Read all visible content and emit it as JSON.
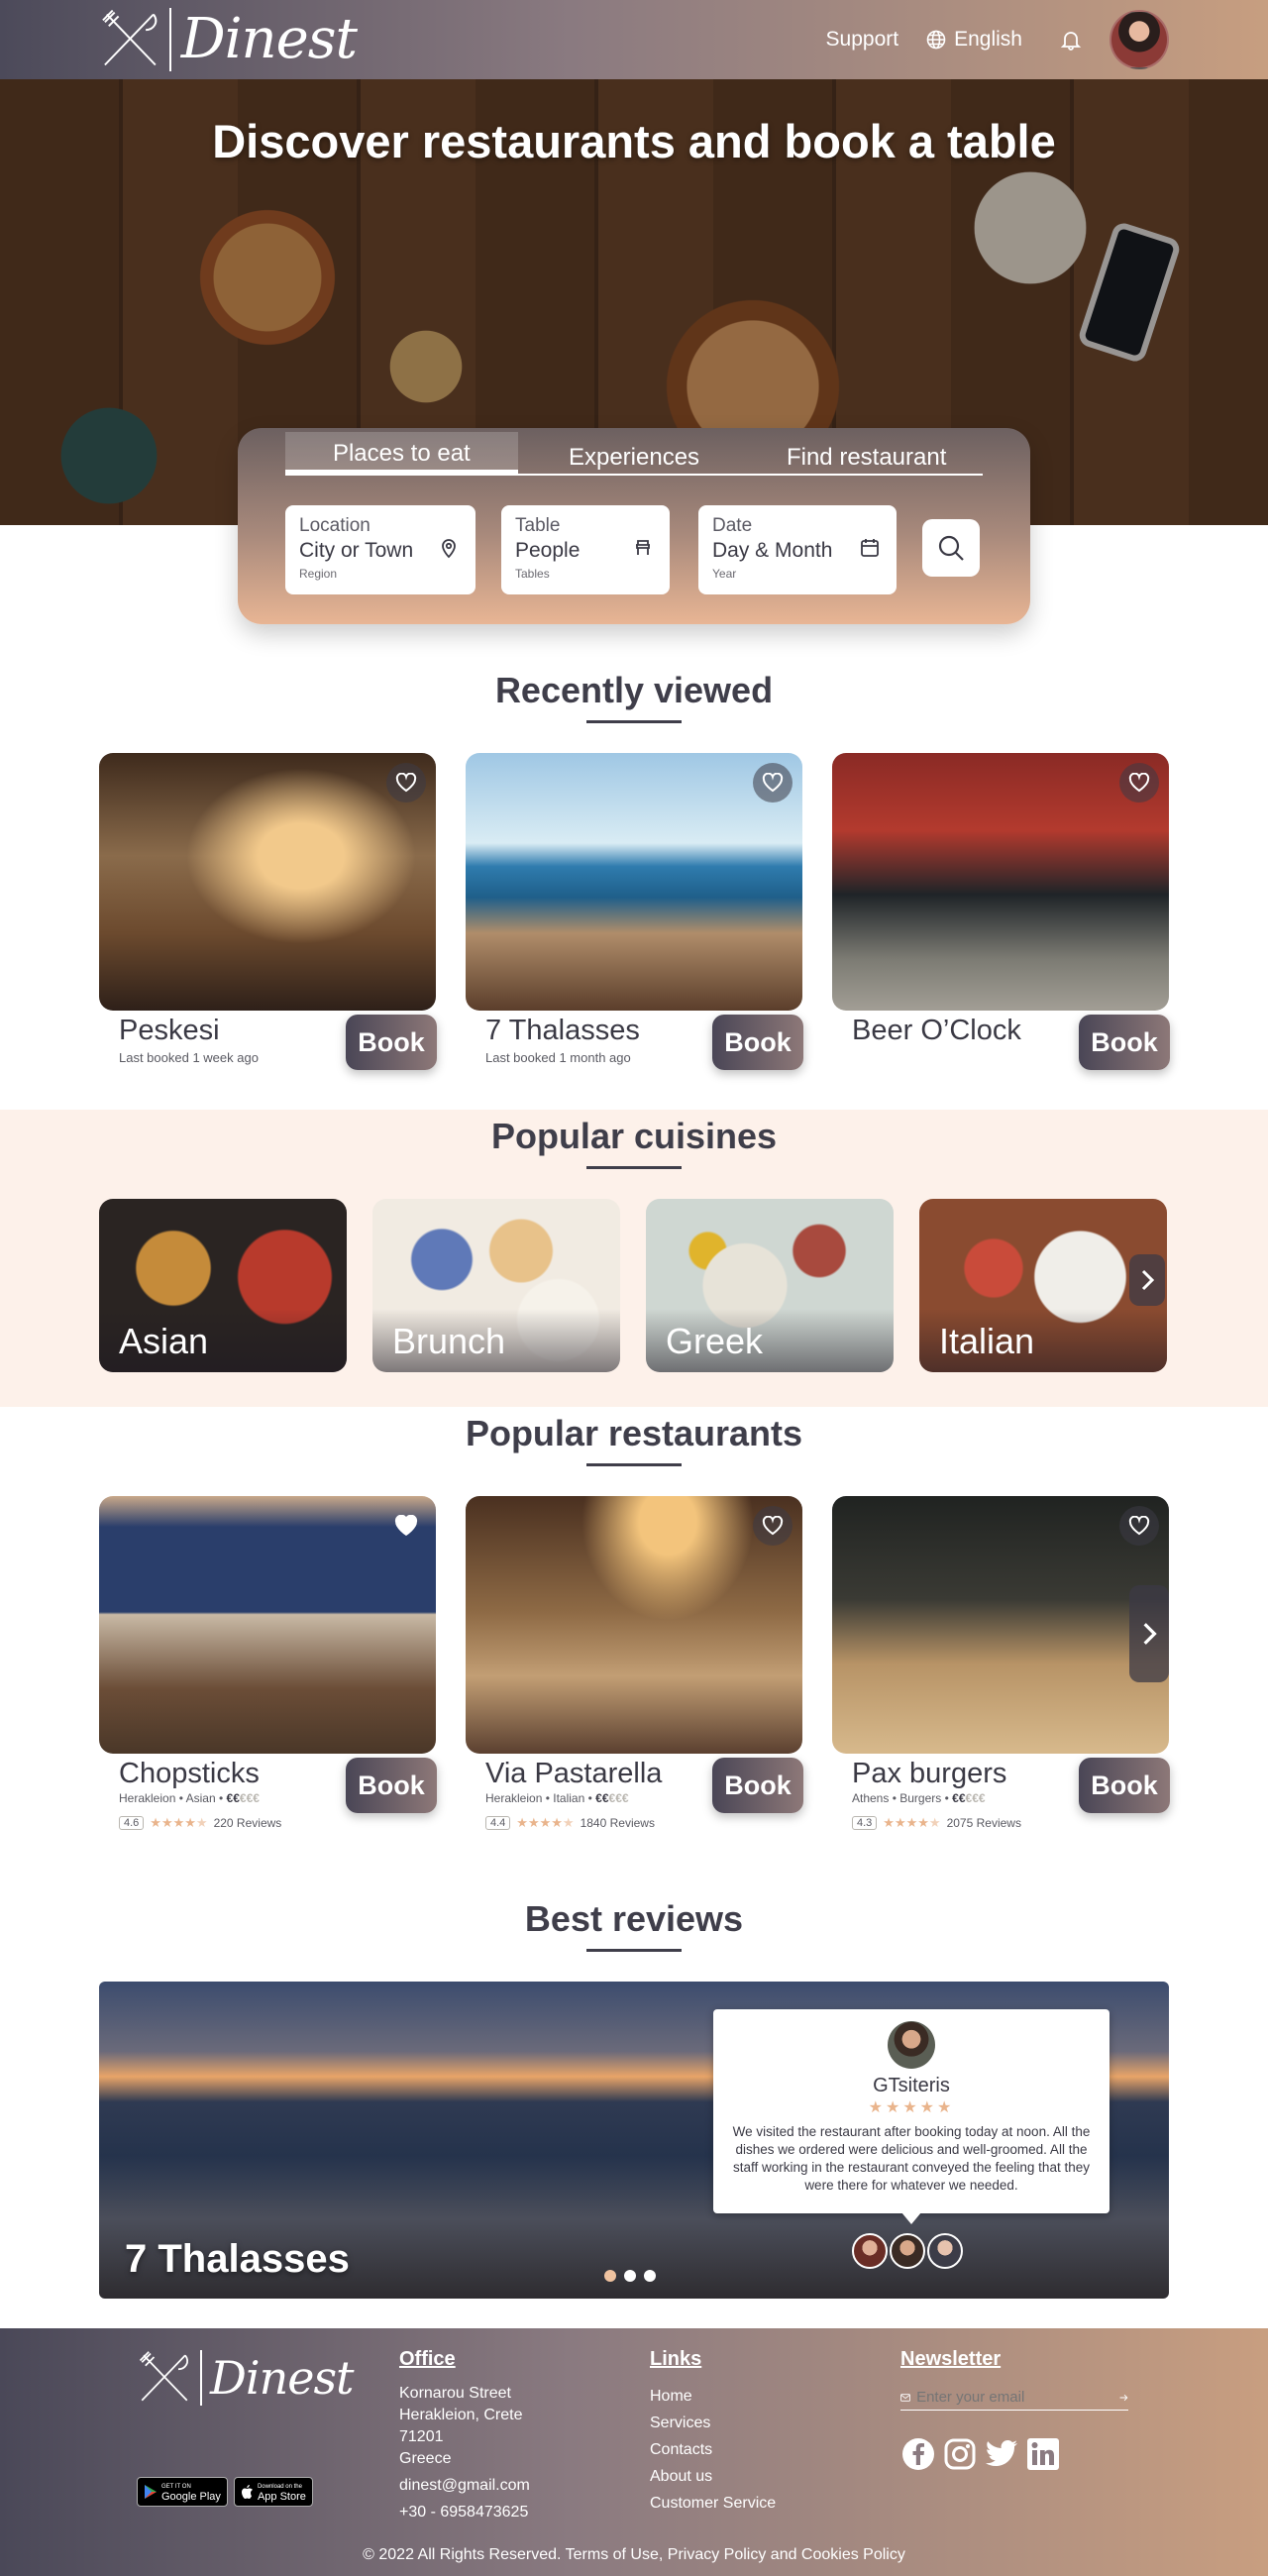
{
  "header": {
    "brand": "Dinest",
    "nav": {
      "support": "Support",
      "language": "English"
    }
  },
  "hero": {
    "title": "Discover restaurants and book a table"
  },
  "search": {
    "tabs": [
      "Places to eat",
      "Experiences",
      "Find restaurant"
    ],
    "location": {
      "label": "Location",
      "value": "City or Town",
      "sub": "Region"
    },
    "table": {
      "label": "Table",
      "value": "People",
      "sub": "Tables"
    },
    "date": {
      "label": "Date",
      "value": "Day & Month",
      "sub": "Year"
    }
  },
  "recently_viewed": {
    "title": "Recently viewed",
    "book_label": "Book",
    "items": [
      {
        "name": "Peskesi",
        "meta": "Last booked 1 week ago"
      },
      {
        "name": "7 Thalasses",
        "meta": "Last booked 1 month ago"
      },
      {
        "name": "Beer O’Clock",
        "meta": ""
      }
    ]
  },
  "cuisines": {
    "title": "Popular cuisines",
    "items": [
      "Asian",
      "Brunch",
      "Greek",
      "Italian"
    ]
  },
  "popular": {
    "title": "Popular restaurants",
    "book_label": "Book",
    "items": [
      {
        "name": "Chopsticks",
        "location": "Herakleion",
        "cuisine": "Asian",
        "price_level": 2,
        "rating": "4.6",
        "stars": 4.6,
        "reviews": "220 Reviews"
      },
      {
        "name": "Via Pastarella",
        "location": "Herakleion",
        "cuisine": "Italian",
        "price_level": 2,
        "rating": "4.4",
        "stars": 4.4,
        "reviews": "1840 Reviews"
      },
      {
        "name": "Pax burgers",
        "location": "Athens",
        "cuisine": "Burgers",
        "price_level": 2,
        "rating": "4.3",
        "stars": 4.3,
        "reviews": "2075 Reviews"
      }
    ]
  },
  "reviews": {
    "title": "Best reviews",
    "restaurant": "7 Thalasses",
    "reviewer": "GTsiteris",
    "stars": 5,
    "text": "We visited the restaurant after booking today at noon. All the dishes we ordered were delicious and well-groomed. All the staff working in the restaurant conveyed the feeling that they were there for whatever we needed.",
    "active_slide": 1,
    "slide_count": 3
  },
  "footer": {
    "brand": "Dinest",
    "office": {
      "heading": "Office",
      "lines": [
        "Kornarou Street",
        "Herakleion, Crete",
        "71201",
        "Greece"
      ],
      "email": "dinest@gmail.com",
      "phone": "+30 - 6958473625"
    },
    "links": {
      "heading": "Links",
      "items": [
        "Home",
        "Services",
        "Contacts",
        "About us",
        "Customer Service"
      ]
    },
    "newsletter": {
      "heading": "Newsletter",
      "placeholder": "Enter your email"
    },
    "stores": {
      "google_small": "GET IT ON",
      "google": "Google Play",
      "apple_small": "Download on the",
      "apple": "App Store"
    },
    "copyright": "© 2022 All Rights Reserved. Terms of Use, Privacy Policy and Cookies Policy"
  },
  "colors": {
    "accent_dark": "#4a4656",
    "accent_warm": "#c89e80",
    "star": "#e9b48c",
    "band": "#fdf1ea"
  }
}
